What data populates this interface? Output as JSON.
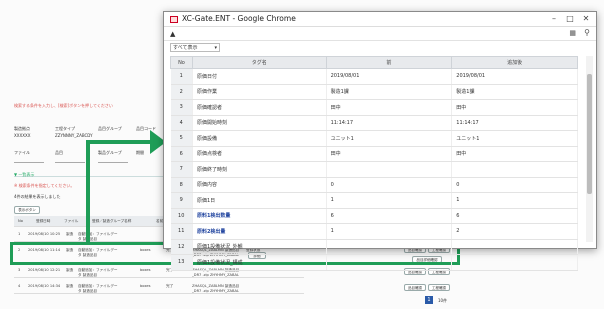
{
  "bg": {
    "notes": [
      "検索する条件を入力し、[検索]ボタンを押してください",
      "※ 検索条件を指定してください。"
    ],
    "field_labels": [
      "製造拠点",
      "工程タイプ",
      "品目グループ",
      "品目コード",
      "ファイル",
      "品目",
      "製品グループ",
      "期間"
    ],
    "field_values": [
      "XXXXXX",
      "ZZYNNNY_ZABCDY"
    ],
    "list_title": "▼ 一覧表示",
    "result_label": "4件の結果を表示しました",
    "search_btn": "表示ボタン",
    "table_headers": [
      "No",
      "登録日時",
      "ファイル",
      "登録／製造グループ名称",
      "名前",
      "状態",
      "",
      "ファイル名"
    ],
    "rows": [
      {
        "no": "1",
        "date": "2019/08/10 10:25",
        "c2": "製造",
        "c3": "自動追加：ファイルデータ 製造品目",
        "c4": "",
        "c5": "",
        "file": "ZHASQL_ZABLMN 製造品目_DR7 .zip ZHYHMY_ZABAL"
      },
      {
        "no": "2",
        "date": "2019/08/10 11:14",
        "c2": "製造",
        "c3": "自動追加：ファイルデータ 製造品目",
        "c4": "boxes",
        "c5": "完了",
        "file": "ZHASQL_ZABLMN 製造品目_DR7 .zip ZHYHMY_ZABAL"
      },
      {
        "no": "3",
        "date": "2019/08/10 12:21",
        "c2": "製造",
        "c3": "自動追加：ファイルデータ 製造品目",
        "c4": "boxes",
        "c5": "完了",
        "file": "ZHASQL_ZABLMN 製造品目_DR7 .zip ZHYHMY_ZABAL"
      },
      {
        "no": "4",
        "date": "2019/08/10 14:34",
        "c2": "製造",
        "c3": "自動追加：ファイルデータ 製造品目",
        "c4": "boxes",
        "c5": "完了",
        "file": "ZHASQL_ZABLMN 製造品目_DR7 .zip ZHYHMY_ZABAL"
      }
    ],
    "status_label": "登録状態",
    "detail_btn": "詳細",
    "right_btns": [
      "品目確認",
      "工程確認",
      "品目詳細確認"
    ],
    "page": "1",
    "per_page": "10件"
  },
  "window": {
    "title": "XC-Gate.ENT - Google Chrome",
    "select_value": "すべて表示",
    "headers": [
      "No",
      "タグ名",
      "前",
      "追加後"
    ],
    "rows": [
      {
        "no": "1",
        "name": "原価日付",
        "before": "2019/08/01",
        "after": "2019/08/01",
        "hl": false
      },
      {
        "no": "2",
        "name": "原価作業",
        "before": "製造1課",
        "after": "製造1課",
        "hl": false
      },
      {
        "no": "3",
        "name": "原価確認者",
        "before": "田中",
        "after": "田中",
        "hl": false
      },
      {
        "no": "4",
        "name": "原価開始時刻",
        "before": "11:14:17",
        "after": "11:14:17",
        "hl": false
      },
      {
        "no": "5",
        "name": "原価設備",
        "before": "ユニット1",
        "after": "ユニット1",
        "hl": false
      },
      {
        "no": "6",
        "name": "原価点検者",
        "before": "田中",
        "after": "田中",
        "hl": false
      },
      {
        "no": "7",
        "name": "原価終了時刻",
        "before": "",
        "after": "",
        "hl": false
      },
      {
        "no": "8",
        "name": "原価内容",
        "before": "0",
        "after": "0",
        "hl": false
      },
      {
        "no": "9",
        "name": "原価1日",
        "before": "1",
        "after": "1",
        "hl": false
      },
      {
        "no": "10",
        "name": "原料1検出数量",
        "before": "6",
        "after": "6",
        "hl": true
      },
      {
        "no": "11",
        "name": "原料2検出量",
        "before": "1",
        "after": "2",
        "hl": true
      },
      {
        "no": "12",
        "name": "原価1設備状況_外観",
        "before": "",
        "after": "",
        "hl": false
      },
      {
        "no": "13",
        "name": "原価1設備状況_構成",
        "before": "",
        "after": "",
        "hl": false
      }
    ]
  },
  "colors": {
    "accent": "#1f9d57",
    "header_bg": "#e8eaed"
  }
}
